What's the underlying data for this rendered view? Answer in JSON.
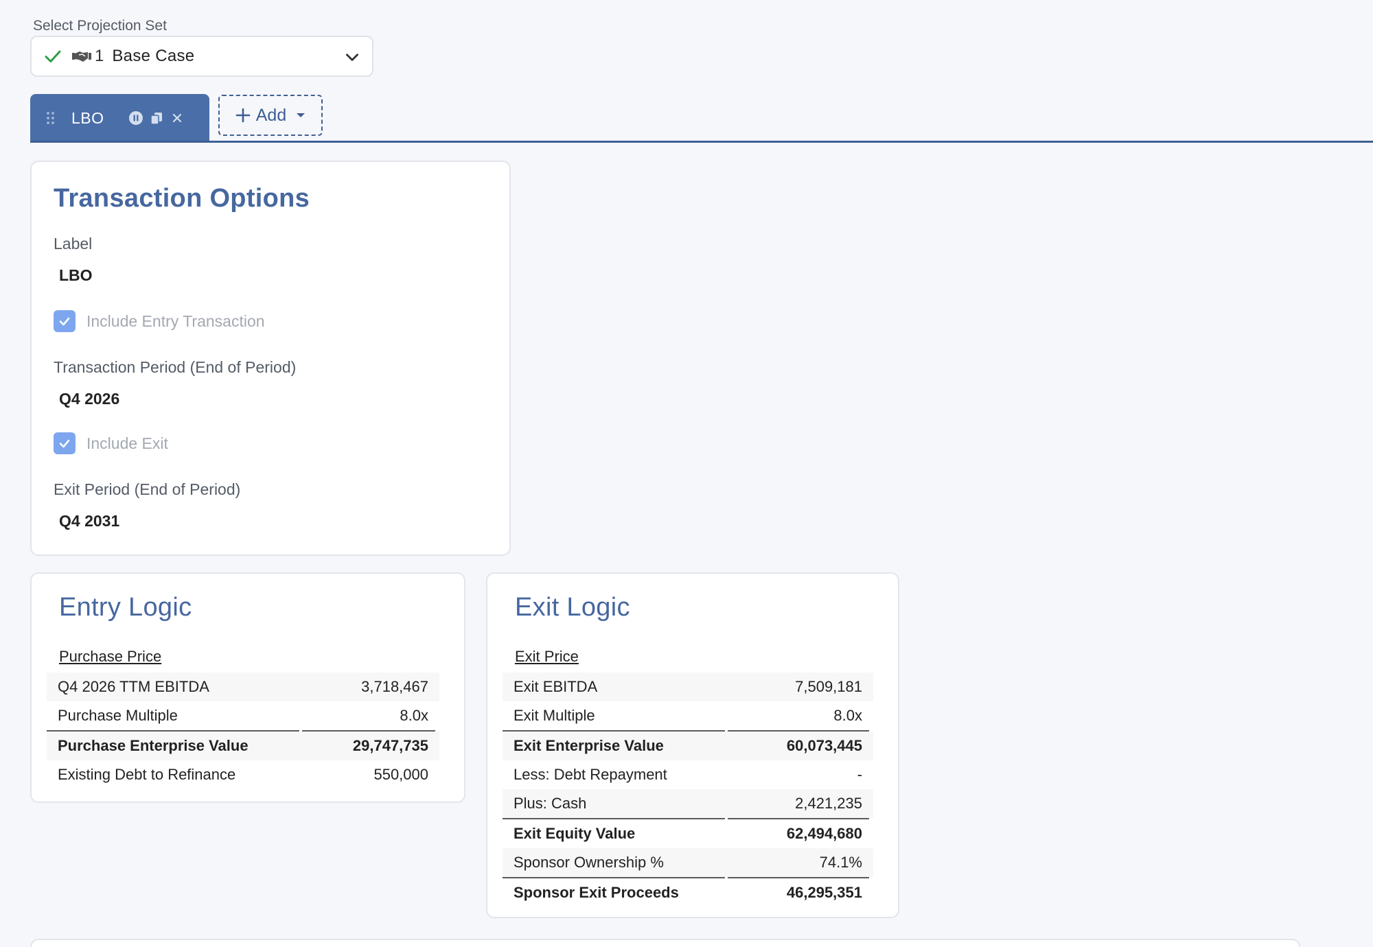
{
  "projection": {
    "label": "Select Projection Set",
    "number": "1",
    "value": "Base Case",
    "icons": [
      "check-icon",
      "handshake-icon",
      "chevron-down-icon"
    ]
  },
  "tabs": {
    "items": [
      {
        "label": "LBO"
      }
    ],
    "add_label": "Add"
  },
  "transaction": {
    "title": "Transaction Options",
    "label_field": "Label",
    "label_value": "LBO",
    "include_entry": "Include Entry Transaction",
    "period_label": "Transaction Period (End of Period)",
    "period_value": "Q4 2026",
    "include_exit": "Include Exit",
    "exit_period_label": "Exit Period (End of Period)",
    "exit_period_value": "Q4 2031"
  },
  "entry": {
    "title": "Entry Logic",
    "section": "Purchase Price",
    "rows": [
      {
        "label": "Q4 2026 TTM EBITDA",
        "value": "3,718,467"
      },
      {
        "label": "Purchase Multiple",
        "value": "8.0x"
      },
      {
        "label": "Purchase Enterprise Value",
        "value": "29,747,735"
      },
      {
        "label": "Existing Debt to Refinance",
        "value": "550,000"
      }
    ]
  },
  "exit": {
    "title": "Exit Logic",
    "section": "Exit Price",
    "rows": [
      {
        "label": "Exit EBITDA",
        "value": "7,509,181"
      },
      {
        "label": "Exit Multiple",
        "value": "8.0x"
      },
      {
        "label": "Exit Enterprise Value",
        "value": "60,073,445"
      },
      {
        "label": "Less: Debt Repayment",
        "value": "-"
      },
      {
        "label": "Plus: Cash",
        "value": "2,421,235"
      },
      {
        "label": "Exit Equity Value",
        "value": "62,494,680"
      },
      {
        "label": "Sponsor Ownership %",
        "value": "74.1%"
      },
      {
        "label": "Sponsor Exit Proceeds",
        "value": "46,295,351"
      }
    ]
  },
  "colors": {
    "accent": "#46679f",
    "tab_bg": "#4a6ea8",
    "checkbox": "#7ea6ef",
    "check_green": "#2e9e44"
  }
}
